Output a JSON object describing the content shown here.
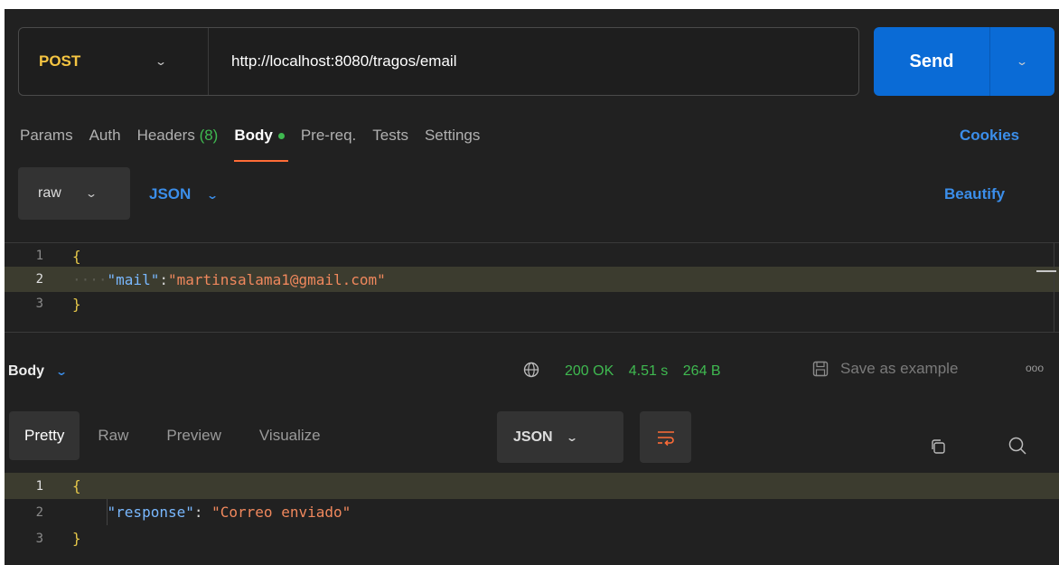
{
  "request": {
    "method": "POST",
    "url": "http://localhost:8080/tragos/email",
    "send_label": "Send"
  },
  "request_tabs": [
    {
      "label": "Params"
    },
    {
      "label": "Auth"
    },
    {
      "label": "Headers",
      "count": "(8)"
    },
    {
      "label": "Body",
      "active": true
    },
    {
      "label": "Pre-req."
    },
    {
      "label": "Tests"
    },
    {
      "label": "Settings"
    }
  ],
  "cookies_label": "Cookies",
  "body_mode": {
    "mode": "raw",
    "language": "JSON",
    "beautify_label": "Beautify"
  },
  "request_body": {
    "lines": [
      {
        "num": "1",
        "text": "{"
      },
      {
        "num": "2",
        "key": "\"mail\"",
        "sep": ":",
        "value": "\"martinsalama1@gmail.com\""
      },
      {
        "num": "3",
        "text": "}"
      }
    ]
  },
  "response": {
    "body_label": "Body",
    "status": "200 OK",
    "time": "4.51 s",
    "size": "264 B",
    "save_example_label": "Save as example",
    "more_label": "ooo",
    "tabs": [
      {
        "label": "Pretty",
        "active": true
      },
      {
        "label": "Raw"
      },
      {
        "label": "Preview"
      },
      {
        "label": "Visualize"
      }
    ],
    "format": "JSON",
    "lines": [
      {
        "num": "1",
        "text": "{"
      },
      {
        "num": "2",
        "key": "\"response\"",
        "sep": ": ",
        "value": "\"Correo enviado\""
      },
      {
        "num": "3",
        "text": "}"
      }
    ]
  },
  "colors": {
    "accent": "#0a6bd6",
    "method": "#f5c542",
    "status_ok": "#3fb950",
    "active_tab_underline": "#ff6c37",
    "link": "#3b8eea"
  }
}
